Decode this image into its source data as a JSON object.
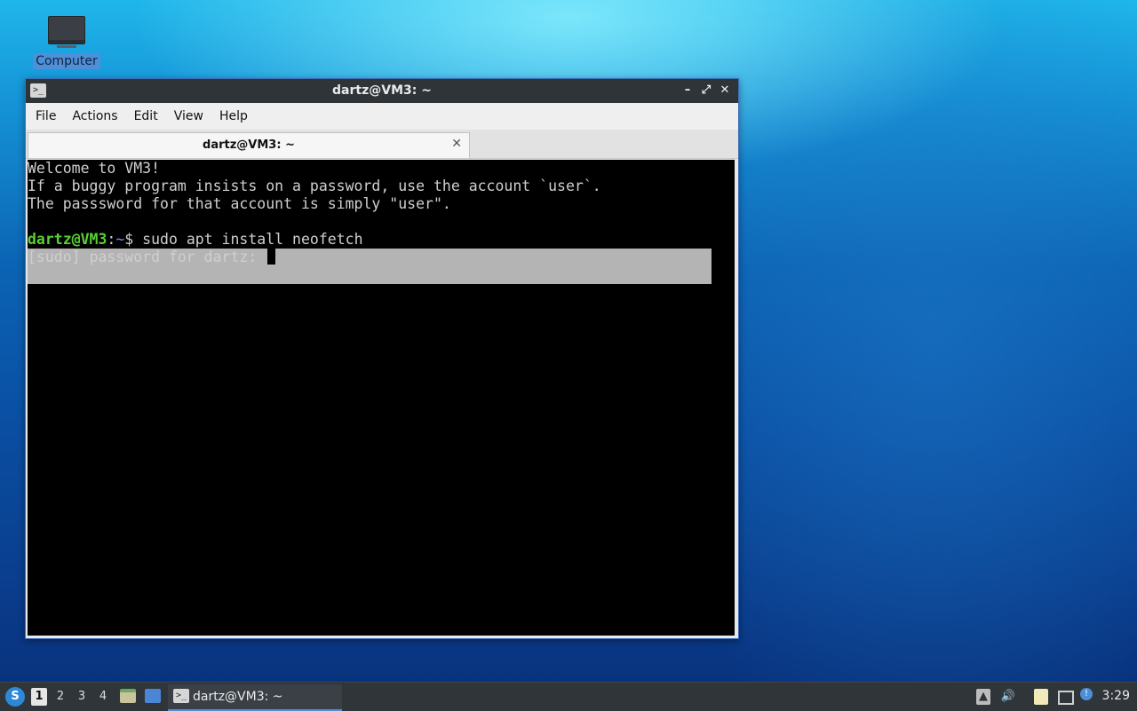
{
  "desktop": {
    "icons": [
      {
        "label": "Computer",
        "icon": "computer-icon"
      }
    ]
  },
  "window": {
    "title": "dartz@VM3: ~",
    "icon": "terminal-icon",
    "controls": {
      "minimize": "–",
      "maximize": "⤢",
      "close": "✕"
    },
    "menu": [
      "File",
      "Actions",
      "Edit",
      "View",
      "Help"
    ],
    "tab": {
      "label": "dartz@VM3: ~",
      "close": "✕"
    },
    "terminal": {
      "lines": [
        "Welcome to VM3!",
        "If a buggy program insists on a password, use the account `user`.",
        "The passsword for that account is simply \"user\"."
      ],
      "prompt_user": "dartz@VM3",
      "prompt_sep": ":",
      "prompt_path": "~",
      "prompt_symbol": "$",
      "command": " sudo apt install neofetch",
      "sudo_prompt": "[sudo] password for dartz:"
    },
    "colors": {
      "prompt_user": "#58d132",
      "prompt_path": "#6f8ff0",
      "selection": "#b4b4b4",
      "frame": "#3d6fb8"
    }
  },
  "taskbar": {
    "start_icon": "lxqt-menu-icon",
    "workspaces": [
      "1",
      "2",
      "3",
      "4"
    ],
    "active_workspace": "1",
    "quick_launch": [
      "file-manager-icon",
      "show-desktop-icon"
    ],
    "task": {
      "label": "dartz@VM3: ~",
      "icon": "terminal-icon"
    },
    "tray": [
      "eject-icon",
      "volume-icon",
      "clipboard-icon",
      "network-icon",
      "notification-icon"
    ],
    "clock": "3:29"
  }
}
